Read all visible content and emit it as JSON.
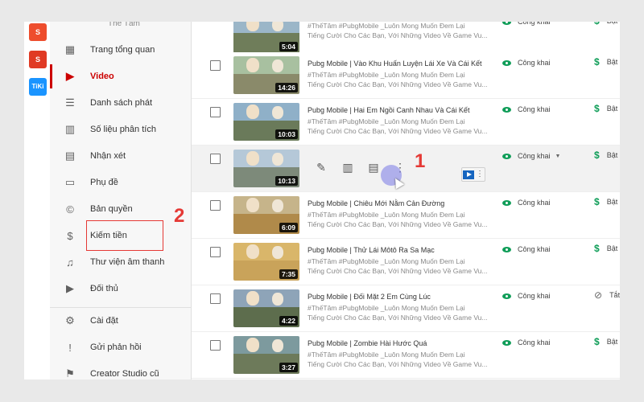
{
  "apps": [
    {
      "name": "Shopee",
      "glyph": "S"
    },
    {
      "name": "Sendo",
      "glyph": "S"
    },
    {
      "name": "Tiki",
      "glyph": "TiKi"
    }
  ],
  "channel": {
    "name": "Thế Tâm"
  },
  "sidebar": {
    "items": [
      {
        "label": "Trang tổng quan",
        "icon": "dashboard-icon",
        "glyph": "▦"
      },
      {
        "label": "Video",
        "icon": "video-icon",
        "glyph": "▶",
        "active": true
      },
      {
        "label": "Danh sách phát",
        "icon": "playlist-icon",
        "glyph": "☰"
      },
      {
        "label": "Số liệu phân tích",
        "icon": "analytics-icon",
        "glyph": "▥"
      },
      {
        "label": "Nhận xét",
        "icon": "comments-icon",
        "glyph": "▤"
      },
      {
        "label": "Phụ đề",
        "icon": "subtitles-icon",
        "glyph": "▭"
      },
      {
        "label": "Bản quyền",
        "icon": "copyright-icon",
        "glyph": "©"
      },
      {
        "label": "Kiếm tiền",
        "icon": "monetization-icon",
        "glyph": "$"
      },
      {
        "label": "Thư viện âm thanh",
        "icon": "audio-library-icon",
        "glyph": "♫"
      },
      {
        "label": "Đối thủ",
        "icon": "competitor-icon",
        "glyph": "▶"
      },
      {
        "label": "Cài đặt",
        "icon": "settings-icon",
        "glyph": "⚙"
      },
      {
        "label": "Gửi phản hồi",
        "icon": "feedback-icon",
        "glyph": "!"
      },
      {
        "label": "Creator Studio cũ",
        "icon": "old-studio-icon",
        "glyph": "⚑"
      }
    ]
  },
  "annotations": {
    "label_1": "1",
    "label_2": "2"
  },
  "visibility_label": "Công khai",
  "monetization_on": "Bật",
  "monetization_off": "Tắt",
  "colors": {
    "accent": "#cc0000",
    "visibility": "#0f9d58",
    "annotation": "#e53935"
  },
  "videos": [
    {
      "title": "",
      "description_1": "#ThếTâm #PubgMobile _Luôn Mong Muốn Đem Lại",
      "description_2": "Tiếng Cười Cho Các Bạn, Với Những Video Về Game Vu...",
      "duration": "5:04",
      "visibility": "Công khai",
      "monetization": "Bật",
      "monetized": true
    },
    {
      "title": "Pubg Mobile | Vào Khu Huấn Luyện Lái Xe Và Cái Kết",
      "description_1": "#ThếTâm #PubgMobile _Luôn Mong Muốn Đem Lại",
      "description_2": "Tiếng Cười Cho Các Bạn, Với Những Video Về Game Vu...",
      "duration": "14:26",
      "visibility": "Công khai",
      "monetization": "Bật",
      "monetized": true
    },
    {
      "title": "Pubg Mobile | Hai Em Ngồi Canh Nhau Và Cái Kết",
      "description_1": "#ThếTâm #PubgMobile _Luôn Mong Muốn Đem Lại",
      "description_2": "Tiếng Cười Cho Các Bạn, Với Những Video Về Game Vu...",
      "duration": "10:03",
      "visibility": "Công khai",
      "monetization": "Bật",
      "monetized": true
    },
    {
      "title": "",
      "description_1": "",
      "description_2": "",
      "duration": "10:13",
      "visibility": "Công khai",
      "monetization": "Bật",
      "monetized": true,
      "hover": true
    },
    {
      "title": "Pubg Mobile | Chiêu Mới Nằm Cản Đường",
      "description_1": "#ThếTâm #PubgMobile _Luôn Mong Muốn Đem Lại",
      "description_2": "Tiếng Cười Cho Các Bạn, Với Những Video Về Game Vu...",
      "duration": "6:09",
      "visibility": "Công khai",
      "monetization": "Bật",
      "monetized": true
    },
    {
      "title": "Pubg Mobile | Thử Lái Môtô Ra Sa Mạc",
      "description_1": "#ThếTâm #PubgMobile _Luôn Mong Muốn Đem Lại",
      "description_2": "Tiếng Cười Cho Các Bạn, Với Những Video Về Game Vu...",
      "duration": "7:35",
      "visibility": "Công khai",
      "monetization": "Bật",
      "monetized": true
    },
    {
      "title": "Pubg Mobile | Đối Mặt 2 Em Cùng Lúc",
      "description_1": "#ThếTâm #PubgMobile _Luôn Mong Muốn Đem Lại",
      "description_2": "Tiếng Cười Cho Các Bạn, Với Những Video Về Game Vu...",
      "duration": "4:22",
      "visibility": "Công khai",
      "monetization": "Tắt",
      "monetized": false
    },
    {
      "title": "Pubg Mobile | Zombie Hài Hước Quá",
      "description_1": "#ThếTâm #PubgMobile _Luôn Mong Muốn Đem Lại",
      "description_2": "Tiếng Cười Cho Các Bạn, Với Những Video Về Game Vu...",
      "duration": "3:27",
      "visibility": "Công khai",
      "monetization": "Bật",
      "monetized": true
    }
  ],
  "hover_actions": [
    {
      "icon": "edit-icon",
      "glyph": "✎"
    },
    {
      "icon": "analytics-icon",
      "glyph": "▥"
    },
    {
      "icon": "comments-icon",
      "glyph": "▤"
    },
    {
      "icon": "more-options-icon",
      "glyph": "⋮"
    }
  ]
}
